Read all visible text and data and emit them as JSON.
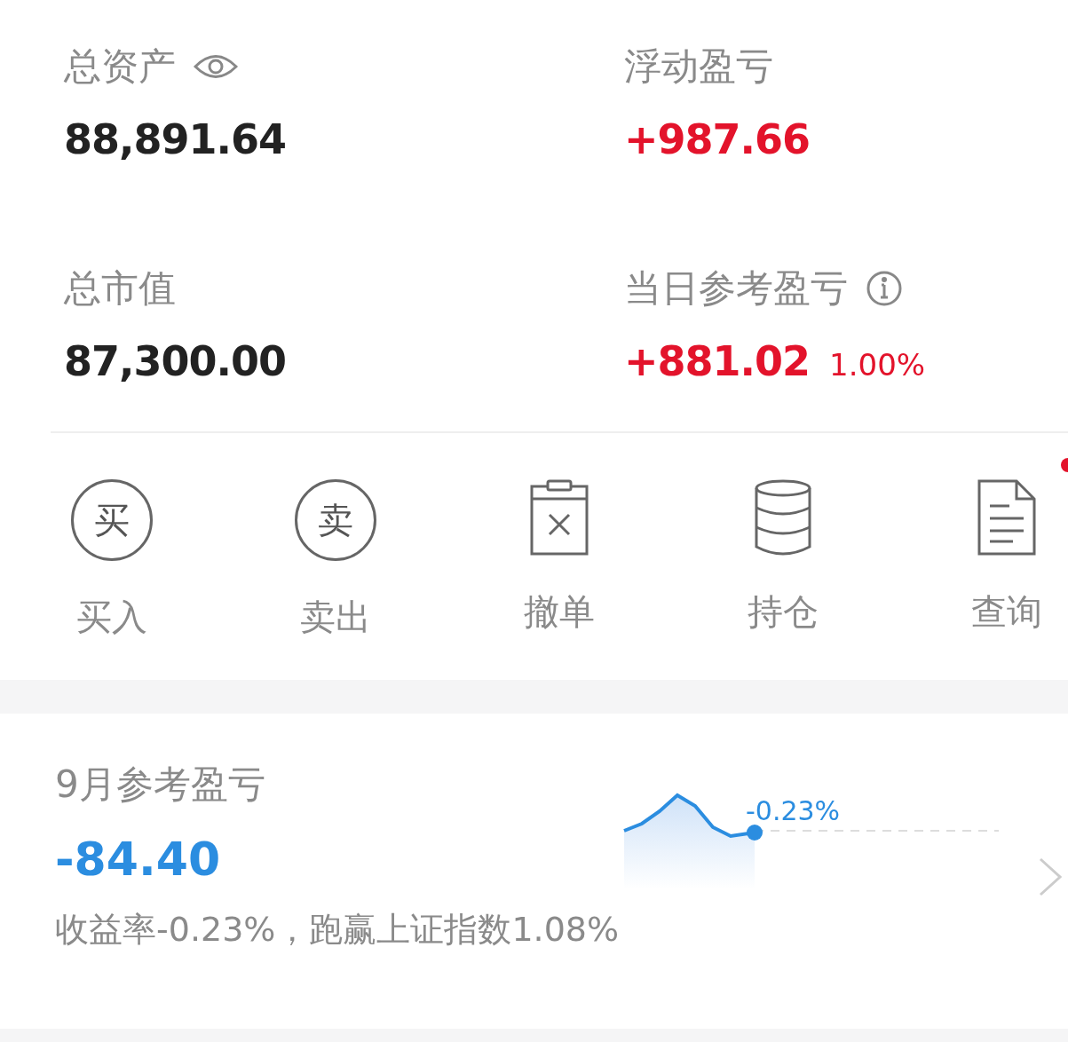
{
  "summary": [
    {
      "label": "总资产",
      "eye_icon": true,
      "value": "88,891.64",
      "positive": false
    },
    {
      "label": "浮动盈亏",
      "value": "+987.66",
      "positive": true
    },
    {
      "label": "总市值",
      "value": "87,300.00",
      "positive": false
    },
    {
      "label": "当日参考盈亏",
      "info_icon": true,
      "value": "+881.02",
      "percent": "1.00%",
      "positive": true
    }
  ],
  "actions": [
    {
      "kind": "glyph",
      "glyph": "买",
      "label": "买入",
      "dot": false
    },
    {
      "kind": "glyph",
      "glyph": "卖",
      "label": "卖出",
      "dot": false
    },
    {
      "kind": "cancel",
      "label": "撤单",
      "dot": false
    },
    {
      "kind": "holdings",
      "label": "持仓",
      "dot": false
    },
    {
      "kind": "query",
      "label": "查询",
      "dot": true
    }
  ],
  "monthly": {
    "title": "9月参考盈亏",
    "value": "-84.40",
    "chart_label": "-0.23%",
    "footer": "收益率-0.23%，跑赢上证指数1.08%"
  }
}
